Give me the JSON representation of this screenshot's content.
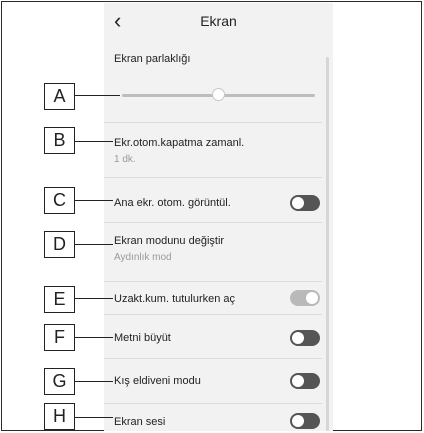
{
  "header": {
    "back_icon": "‹",
    "title": "Ekran"
  },
  "brightness": {
    "label": "Ekran parlaklığı",
    "level_percent": 50
  },
  "rows": [
    {
      "key": "B",
      "label": "Ekr.otom.kapatma zamanl.",
      "sub": "1 dk."
    },
    {
      "key": "C",
      "label": "Ana ekr. otom. görüntül.",
      "toggle": "off"
    },
    {
      "key": "D",
      "label": "Ekran modunu değiştir",
      "sub": "Aydınlık mod"
    },
    {
      "key": "E",
      "label": "Uzakt.kum. tutulurken aç",
      "toggle": "on-disabled"
    },
    {
      "key": "F",
      "label": "Metni büyüt",
      "toggle": "off"
    },
    {
      "key": "G",
      "label": "Kış eldiveni modu",
      "toggle": "off"
    },
    {
      "key": "H",
      "label": "Ekran sesi",
      "toggle": "off"
    }
  ],
  "callouts": [
    "A",
    "B",
    "C",
    "D",
    "E",
    "F",
    "G",
    "H"
  ],
  "colors": {
    "toggle_off": "#555555",
    "toggle_disabled": "#b9b9b9",
    "screen_bg": "#f2f2f2"
  }
}
